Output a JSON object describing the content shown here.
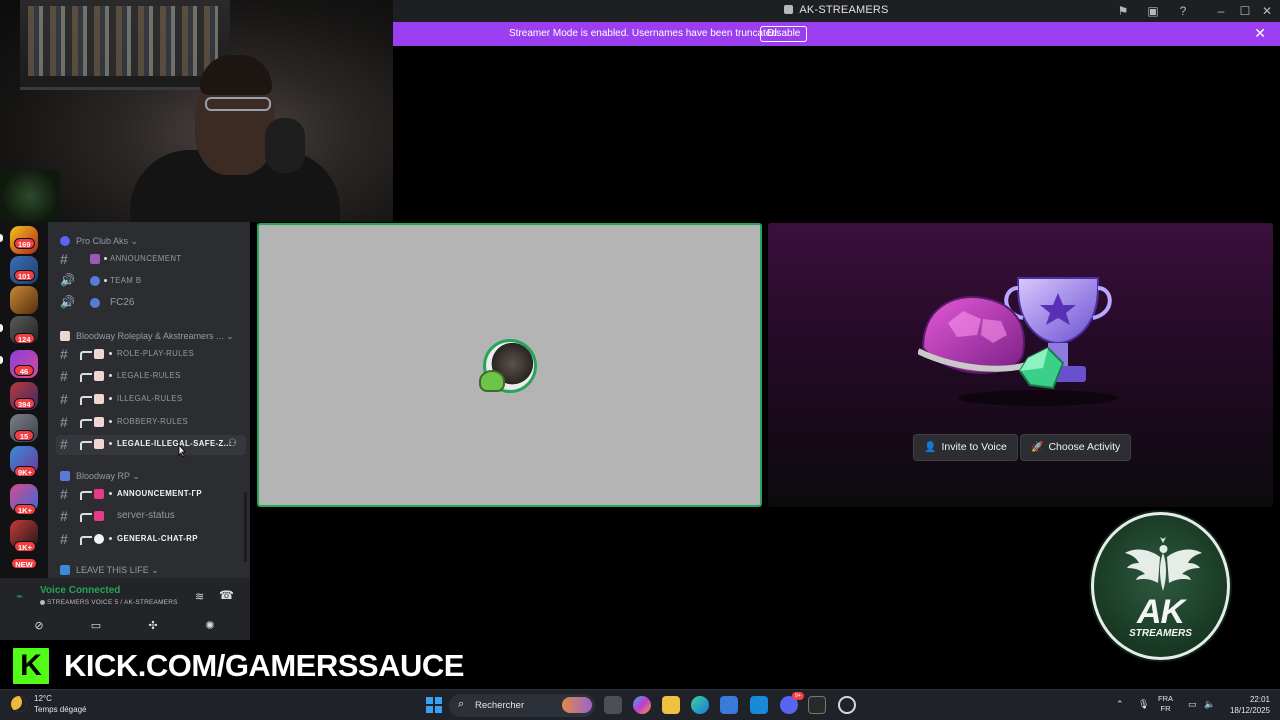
{
  "window": {
    "title": "AK-STREAMERS"
  },
  "banner": {
    "message": "Streamer Mode is enabled. Usernames have been truncated.",
    "disable_label": "Disable"
  },
  "server_rail": {
    "badges": [
      "169",
      "101",
      "124",
      "46",
      "394",
      "15",
      "9K+",
      "1K+",
      "1K+"
    ],
    "new_label": "NEW"
  },
  "sidebar": {
    "categories": [
      {
        "label": "Pro Club Aks"
      },
      {
        "label": "Bloodway Roleplay & Akstreamers ..."
      },
      {
        "label": "Bloodway RP"
      },
      {
        "label": "LEAVE THIS LIFE"
      }
    ],
    "channels": [
      {
        "label": "ANNOUNCEMENT"
      },
      {
        "label": "TEAM B"
      },
      {
        "label": "FC26"
      },
      {
        "label": "ROLE-PLAY-RULES"
      },
      {
        "label": "LEGALE-RULES"
      },
      {
        "label": "ILLEGAL-RULES"
      },
      {
        "label": "ROBBERY-RULES"
      },
      {
        "label": "LEGALE-ILLEGAL-SAFE-Z..."
      },
      {
        "label": "ANNOUNCEMENT-гр"
      },
      {
        "label": "server-status"
      },
      {
        "label": "GENERAL-CHAT-RP"
      }
    ]
  },
  "voice_panel": {
    "status": "Voice Connected",
    "channel": "STREAMERS VOICE 5 / AK-STREAMERS"
  },
  "activity": {
    "invite_label": "Invite to Voice",
    "choose_label": "Choose Activity"
  },
  "overlay": {
    "kick_letter": "K",
    "kick_url": "KICK.COM/GAMERSSAUCE",
    "logo_main": "AK",
    "logo_sub": "STREAMERS"
  },
  "taskbar": {
    "temperature": "12°C",
    "weather": "Temps dégagé",
    "search_placeholder": "Rechercher",
    "lang_top": "FRA",
    "lang_bottom": "FR",
    "time": "22:01",
    "date": "18/12/2025",
    "discord_badge": "9+"
  },
  "colors": {
    "banner": "#9b3ef0",
    "voice_green": "#23a55a",
    "kick_green": "#53fc18",
    "sidebar_bg": "#2b2d31"
  }
}
